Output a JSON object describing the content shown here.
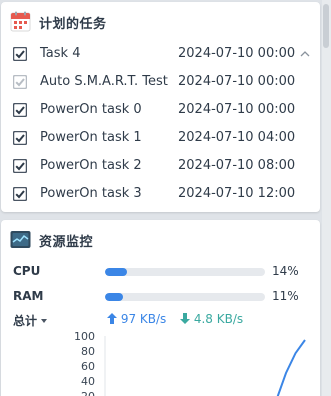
{
  "tasks_widget": {
    "title": "计划的任务",
    "icon": "calendar-icon",
    "tasks": [
      {
        "name": "Task 4",
        "time": "2024-07-10 00:00",
        "checked": true
      },
      {
        "name": "Auto S.M.A.R.T. Test",
        "time": "2024-07-10 00:00",
        "checked": true,
        "disabled": true
      },
      {
        "name": "PowerOn task 0",
        "time": "2024-07-10 00:00",
        "checked": true
      },
      {
        "name": "PowerOn task 1",
        "time": "2024-07-10 04:00",
        "checked": true
      },
      {
        "name": "PowerOn task 2",
        "time": "2024-07-10 08:00",
        "checked": true
      },
      {
        "name": "PowerOn task 3",
        "time": "2024-07-10 12:00",
        "checked": true
      }
    ]
  },
  "resource_widget": {
    "title": "资源监控",
    "icon": "resource-monitor-icon",
    "cpu": {
      "label": "CPU",
      "percent_text": "14%",
      "value": 14
    },
    "ram": {
      "label": "RAM",
      "percent_text": "11%",
      "value": 11
    },
    "network": {
      "selector_label": "总计",
      "upload_text": "97 KB/s",
      "download_text": "4.8 KB/s"
    },
    "colors": {
      "accent": "#3b86e6",
      "download": "#3aa9a0"
    }
  },
  "chart_data": {
    "type": "line",
    "title": "",
    "xlabel": "",
    "ylabel": "",
    "ylim": [
      0,
      100
    ],
    "yticks": [
      "100",
      "80",
      "60",
      "40",
      "20"
    ],
    "grid": false,
    "series": [
      {
        "values": [
          0,
          0,
          0,
          0,
          0,
          0,
          0,
          0,
          0,
          0,
          0,
          0,
          0,
          0,
          0,
          0,
          0,
          0,
          0,
          45,
          78,
          100
        ]
      }
    ]
  }
}
